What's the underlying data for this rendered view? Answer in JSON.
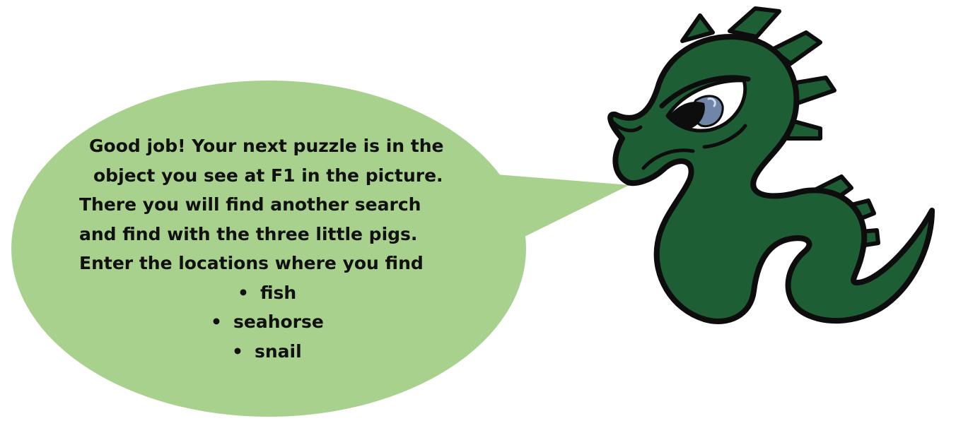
{
  "speech": {
    "lines": [
      "Good job! Your next puzzle is in the",
      "object you see at F1 in the picture.",
      "There you will find another search",
      "and find with the three little pigs.",
      "Enter the locations where you find"
    ],
    "bullet_char": "•",
    "items": [
      "fish",
      "seahorse",
      "snail"
    ]
  },
  "colors": {
    "bubble": "#a9d18e",
    "dragon_body": "#1e5e35",
    "dragon_outline": "#0d0d0d",
    "eye_iris": "#6f86a8"
  },
  "icons": {
    "character": "green-dragon-icon"
  }
}
